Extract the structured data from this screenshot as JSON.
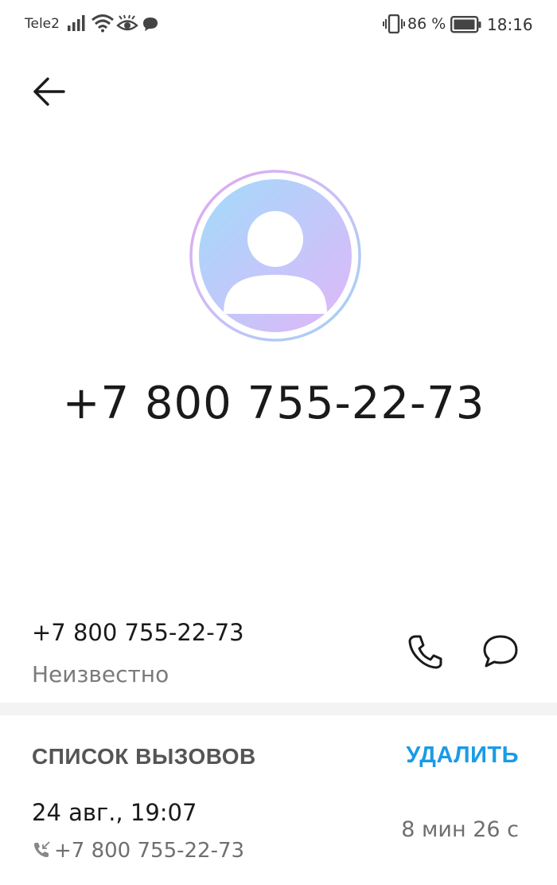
{
  "status_bar": {
    "carrier": "Tele2",
    "battery_percent": "86 %",
    "time": "18:16",
    "icons": [
      "signal-icon",
      "wifi-icon",
      "eye-icon",
      "chat-bubble-icon",
      "vibrate-icon",
      "battery-icon"
    ]
  },
  "contact": {
    "title_number": "+7 800 755-22-73",
    "number": "+7 800 755-22-73",
    "label": "Неизвестно"
  },
  "call_log": {
    "title": "СПИСОК ВЫЗОВОВ",
    "delete_label": "УДАЛИТЬ",
    "entries": [
      {
        "date": "24 авг., 19:07",
        "number": "+7 800 755-22-73",
        "duration": "8 мин 26 с",
        "type_icon": "incoming-call-icon"
      }
    ]
  },
  "colors": {
    "accent": "#1a9be6",
    "avatar_gradient_start": "#a6d8fb",
    "avatar_gradient_end": "#d9b8f8"
  }
}
